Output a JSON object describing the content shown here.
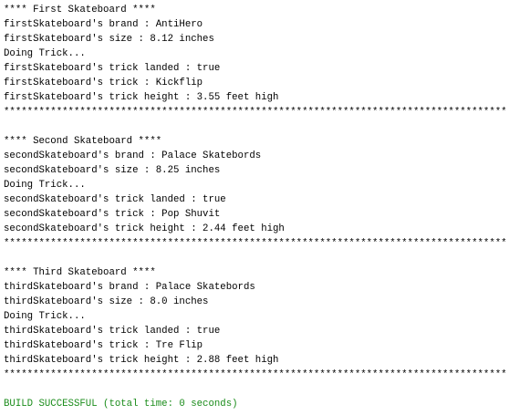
{
  "console": {
    "lines": [
      {
        "text": "**** First Skateboard ****",
        "kind": "heading"
      },
      {
        "text": "firstSkateboard's brand : AntiHero",
        "kind": "output"
      },
      {
        "text": "firstSkateboard's size : 8.12 inches",
        "kind": "output"
      },
      {
        "text": "Doing Trick...",
        "kind": "output"
      },
      {
        "text": "firstSkateboard's trick landed : true",
        "kind": "output"
      },
      {
        "text": "firstSkateboard's trick : Kickflip",
        "kind": "output"
      },
      {
        "text": "firstSkateboard's trick height : 3.55 feet high",
        "kind": "output"
      },
      {
        "text": "**************************************************************************************",
        "kind": "separator"
      },
      {
        "text": "",
        "kind": "blank"
      },
      {
        "text": "**** Second Skateboard ****",
        "kind": "heading"
      },
      {
        "text": "secondSkateboard's brand : Palace Skatebords",
        "kind": "output"
      },
      {
        "text": "secondSkateboard's size : 8.25 inches",
        "kind": "output"
      },
      {
        "text": "Doing Trick...",
        "kind": "output"
      },
      {
        "text": "secondSkateboard's trick landed : true",
        "kind": "output"
      },
      {
        "text": "secondSkateboard's trick : Pop Shuvit",
        "kind": "output"
      },
      {
        "text": "secondSkateboard's trick height : 2.44 feet high",
        "kind": "output"
      },
      {
        "text": "**************************************************************************************",
        "kind": "separator"
      },
      {
        "text": "",
        "kind": "blank"
      },
      {
        "text": "**** Third Skateboard ****",
        "kind": "heading"
      },
      {
        "text": "thirdSkateboard's brand : Palace Skatebords",
        "kind": "output"
      },
      {
        "text": "thirdSkateboard's size : 8.0 inches",
        "kind": "output"
      },
      {
        "text": "Doing Trick...",
        "kind": "output"
      },
      {
        "text": "thirdSkateboard's trick landed : true",
        "kind": "output"
      },
      {
        "text": "thirdSkateboard's trick : Tre Flip",
        "kind": "output"
      },
      {
        "text": "thirdSkateboard's trick height : 2.88 feet high",
        "kind": "output"
      },
      {
        "text": "**************************************************************************************",
        "kind": "separator"
      },
      {
        "text": "",
        "kind": "blank"
      },
      {
        "text": "BUILD SUCCESSFUL (total time: 0 seconds)",
        "kind": "success"
      }
    ]
  },
  "colors": {
    "text": "#000000",
    "success": "#1a8c1a",
    "background": "#ffffff"
  }
}
